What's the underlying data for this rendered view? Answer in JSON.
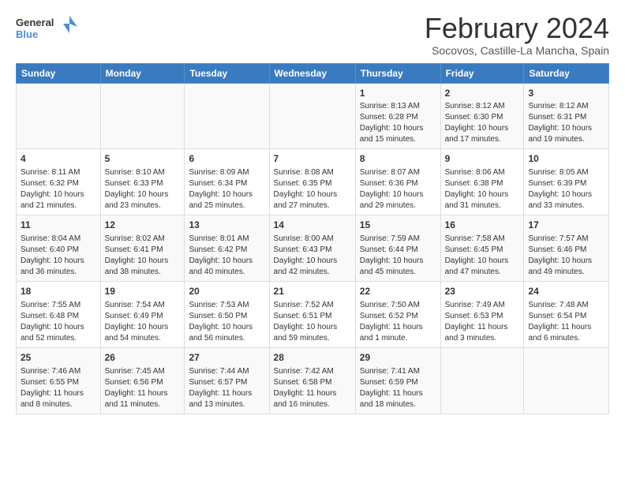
{
  "header": {
    "logo_line1": "General",
    "logo_line2": "Blue",
    "month": "February 2024",
    "location": "Socovos, Castille-La Mancha, Spain"
  },
  "columns": [
    "Sunday",
    "Monday",
    "Tuesday",
    "Wednesday",
    "Thursday",
    "Friday",
    "Saturday"
  ],
  "weeks": [
    [
      {
        "day": "",
        "info": ""
      },
      {
        "day": "",
        "info": ""
      },
      {
        "day": "",
        "info": ""
      },
      {
        "day": "",
        "info": ""
      },
      {
        "day": "1",
        "info": "Sunrise: 8:13 AM\nSunset: 6:28 PM\nDaylight: 10 hours\nand 15 minutes."
      },
      {
        "day": "2",
        "info": "Sunrise: 8:12 AM\nSunset: 6:30 PM\nDaylight: 10 hours\nand 17 minutes."
      },
      {
        "day": "3",
        "info": "Sunrise: 8:12 AM\nSunset: 6:31 PM\nDaylight: 10 hours\nand 19 minutes."
      }
    ],
    [
      {
        "day": "4",
        "info": "Sunrise: 8:11 AM\nSunset: 6:32 PM\nDaylight: 10 hours\nand 21 minutes."
      },
      {
        "day": "5",
        "info": "Sunrise: 8:10 AM\nSunset: 6:33 PM\nDaylight: 10 hours\nand 23 minutes."
      },
      {
        "day": "6",
        "info": "Sunrise: 8:09 AM\nSunset: 6:34 PM\nDaylight: 10 hours\nand 25 minutes."
      },
      {
        "day": "7",
        "info": "Sunrise: 8:08 AM\nSunset: 6:35 PM\nDaylight: 10 hours\nand 27 minutes."
      },
      {
        "day": "8",
        "info": "Sunrise: 8:07 AM\nSunset: 6:36 PM\nDaylight: 10 hours\nand 29 minutes."
      },
      {
        "day": "9",
        "info": "Sunrise: 8:06 AM\nSunset: 6:38 PM\nDaylight: 10 hours\nand 31 minutes."
      },
      {
        "day": "10",
        "info": "Sunrise: 8:05 AM\nSunset: 6:39 PM\nDaylight: 10 hours\nand 33 minutes."
      }
    ],
    [
      {
        "day": "11",
        "info": "Sunrise: 8:04 AM\nSunset: 6:40 PM\nDaylight: 10 hours\nand 36 minutes."
      },
      {
        "day": "12",
        "info": "Sunrise: 8:02 AM\nSunset: 6:41 PM\nDaylight: 10 hours\nand 38 minutes."
      },
      {
        "day": "13",
        "info": "Sunrise: 8:01 AM\nSunset: 6:42 PM\nDaylight: 10 hours\nand 40 minutes."
      },
      {
        "day": "14",
        "info": "Sunrise: 8:00 AM\nSunset: 6:43 PM\nDaylight: 10 hours\nand 42 minutes."
      },
      {
        "day": "15",
        "info": "Sunrise: 7:59 AM\nSunset: 6:44 PM\nDaylight: 10 hours\nand 45 minutes."
      },
      {
        "day": "16",
        "info": "Sunrise: 7:58 AM\nSunset: 6:45 PM\nDaylight: 10 hours\nand 47 minutes."
      },
      {
        "day": "17",
        "info": "Sunrise: 7:57 AM\nSunset: 6:46 PM\nDaylight: 10 hours\nand 49 minutes."
      }
    ],
    [
      {
        "day": "18",
        "info": "Sunrise: 7:55 AM\nSunset: 6:48 PM\nDaylight: 10 hours\nand 52 minutes."
      },
      {
        "day": "19",
        "info": "Sunrise: 7:54 AM\nSunset: 6:49 PM\nDaylight: 10 hours\nand 54 minutes."
      },
      {
        "day": "20",
        "info": "Sunrise: 7:53 AM\nSunset: 6:50 PM\nDaylight: 10 hours\nand 56 minutes."
      },
      {
        "day": "21",
        "info": "Sunrise: 7:52 AM\nSunset: 6:51 PM\nDaylight: 10 hours\nand 59 minutes."
      },
      {
        "day": "22",
        "info": "Sunrise: 7:50 AM\nSunset: 6:52 PM\nDaylight: 11 hours\nand 1 minute."
      },
      {
        "day": "23",
        "info": "Sunrise: 7:49 AM\nSunset: 6:53 PM\nDaylight: 11 hours\nand 3 minutes."
      },
      {
        "day": "24",
        "info": "Sunrise: 7:48 AM\nSunset: 6:54 PM\nDaylight: 11 hours\nand 6 minutes."
      }
    ],
    [
      {
        "day": "25",
        "info": "Sunrise: 7:46 AM\nSunset: 6:55 PM\nDaylight: 11 hours\nand 8 minutes."
      },
      {
        "day": "26",
        "info": "Sunrise: 7:45 AM\nSunset: 6:56 PM\nDaylight: 11 hours\nand 11 minutes."
      },
      {
        "day": "27",
        "info": "Sunrise: 7:44 AM\nSunset: 6:57 PM\nDaylight: 11 hours\nand 13 minutes."
      },
      {
        "day": "28",
        "info": "Sunrise: 7:42 AM\nSunset: 6:58 PM\nDaylight: 11 hours\nand 16 minutes."
      },
      {
        "day": "29",
        "info": "Sunrise: 7:41 AM\nSunset: 6:59 PM\nDaylight: 11 hours\nand 18 minutes."
      },
      {
        "day": "",
        "info": ""
      },
      {
        "day": "",
        "info": ""
      }
    ]
  ]
}
